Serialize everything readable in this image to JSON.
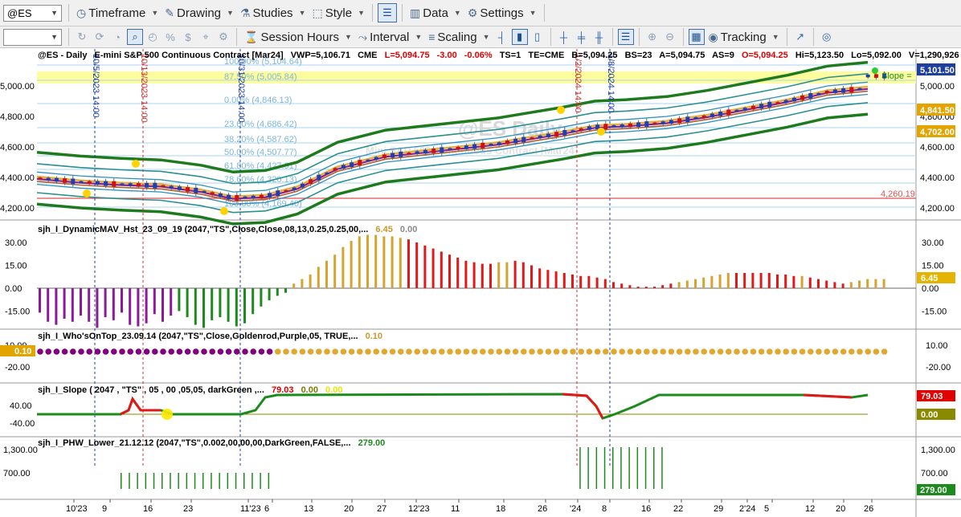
{
  "toolbar1": {
    "symbol": "@ES",
    "timeframe": "Timeframe",
    "drawing": "Drawing",
    "studies": "Studies",
    "style": "Style",
    "data": "Data",
    "settings": "Settings"
  },
  "toolbar2": {
    "combo_value": "",
    "session_hours": "Session Hours",
    "interval": "Interval",
    "scaling": "Scaling",
    "tracking": "Tracking"
  },
  "price_pane": {
    "header_symbol": "@ES - Daily",
    "header_desc": "E-mini S&P 500 Continuous Contract [Mar24]",
    "vwp": "VWP=5,106.71",
    "exchange": "CME",
    "last": "L=5,094.75",
    "chg": "-3.00",
    "pct": "-0.06%",
    "ts": "TS=1",
    "te": "TE=CME",
    "bid": "B=5,094.25",
    "bs": "BS=23",
    "ask": "A=5,094.75",
    "as": "AS=9",
    "open": "O=5,094.25",
    "hi": "Hi=5,123.50",
    "lo": "Lo=5,092.00",
    "vol": "V=1,290,926",
    "watermark": "@ES Daily",
    "watermark_sub": "Mini S&P 500 Continuous Contract [Mar24]",
    "slope_label": "Slope =",
    "axis_ticks": [
      "5,000.00",
      "4,800.00",
      "4,600.00",
      "4,400.00",
      "4,200.00"
    ],
    "badges": {
      "last": "5,101.50",
      "green": "4,841.50",
      "orange": "4,702.00",
      "red": "4,260.19"
    },
    "fib_levels": [
      "100.00% (5,104.64)",
      "87.50% (5,005.84)",
      "0.00% (4,846.13)",
      "23.60% (4,686.42)",
      "38.20% (4,587.62)",
      "50.00% (4,507.77)",
      "61.80% (4,427.91)",
      "78.60% (4,320.13)",
      "100.00% (4,169.40)"
    ],
    "vlines": [
      "10/5/2023 14:00",
      "10/13/2023 14:00",
      "10/31/2023 14:00",
      "1/2/2024 14:00",
      "1/8/2024 14:00"
    ]
  },
  "hist_pane": {
    "title": "sjh_I_DynamicMAV_Hst_23_09_19 (2047,\"TS\",Close,Close,08,13,0.25,0.25,00,...",
    "v1": "6.45",
    "v2": "0.00",
    "axis_ticks": [
      "30.00",
      "15.00",
      "0.00",
      "-15.00"
    ],
    "badge": "6.45",
    "bars": [
      -16,
      -22,
      -24,
      -20,
      -22,
      -18,
      -22,
      -26,
      -19,
      -21,
      -16,
      -24,
      -25,
      -23,
      -17,
      -22,
      -18,
      -15,
      -19,
      -24,
      -26,
      -21,
      -19,
      -22,
      -25,
      -23,
      -17,
      -12,
      -8,
      -5,
      -3,
      3,
      6,
      9,
      14,
      18,
      22,
      27,
      31,
      34,
      35,
      35,
      34,
      34,
      33,
      32,
      30,
      28,
      26,
      24,
      22,
      20,
      18,
      17,
      16,
      16,
      17,
      17,
      18,
      17,
      15,
      13,
      12,
      11,
      10,
      9,
      8,
      8,
      7,
      6,
      4,
      3,
      2,
      1,
      1,
      1,
      2,
      3,
      4,
      5,
      6,
      7,
      8,
      9,
      10,
      10,
      10,
      10,
      10,
      10,
      9,
      9,
      8,
      8,
      7,
      6,
      5,
      4,
      3,
      4,
      5,
      6,
      6,
      6
    ],
    "colors": [
      "p",
      "p",
      "p",
      "p",
      "p",
      "p",
      "p",
      "p",
      "p",
      "p",
      "p",
      "p",
      "p",
      "p",
      "p",
      "p",
      "p",
      "g",
      "g",
      "g",
      "g",
      "g",
      "g",
      "g",
      "g",
      "g",
      "g",
      "g",
      "g",
      "g",
      "g",
      "o",
      "o",
      "o",
      "o",
      "o",
      "o",
      "o",
      "o",
      "o",
      "o",
      "o",
      "o",
      "o",
      "o",
      "r",
      "r",
      "r",
      "r",
      "r",
      "r",
      "r",
      "r",
      "r",
      "r",
      "r",
      "o",
      "o",
      "r",
      "r",
      "r",
      "r",
      "r",
      "r",
      "r",
      "r",
      "r",
      "r",
      "r",
      "r",
      "r",
      "r",
      "r",
      "r",
      "r",
      "r",
      "r",
      "r",
      "o",
      "o",
      "o",
      "o",
      "o",
      "o",
      "o",
      "r",
      "r",
      "r",
      "r",
      "r",
      "r",
      "r",
      "r",
      "o",
      "r",
      "r",
      "r",
      "r",
      "r",
      "o",
      "o",
      "o",
      "o",
      "o"
    ]
  },
  "top_pane": {
    "title": "sjh_I_Who'sOnTop_23.09.14 (2047,\"TS\",Close,Goldenrod,Purple,05,  TRUE,...",
    "v1": "0.10",
    "axis_ticks": [
      "10.00",
      "-20.00"
    ],
    "badge_left": "0.10"
  },
  "slope_pane": {
    "title": "sjh_I_Slope ( 2047 , \"TS\" , 05 , 00 ,05,05, darkGreen ,...",
    "v1": "79.03",
    "v2": "0.00",
    "v3": "0.00",
    "axis_ticks": [
      "40.00",
      "-40.00"
    ],
    "badge_red": "79.03",
    "badge_olive": "0.00"
  },
  "phw_pane": {
    "title": "sjh_I_PHW_Lower_21.12.12 (2047,\"TS\",0.002,00,00,00,DarkGreen,FALSE,...",
    "v1": "279.00",
    "axis_ticks": [
      "1,300.00",
      "700.00"
    ],
    "badge": "279.00",
    "bars": [
      0,
      0,
      0,
      0,
      0,
      0,
      0,
      0,
      0,
      0,
      0,
      0,
      0,
      0,
      0,
      0,
      0,
      0,
      0,
      0,
      0,
      0,
      0,
      0,
      0,
      0,
      0,
      0,
      0,
      0,
      0,
      0,
      0,
      0,
      0,
      0,
      0,
      0,
      0,
      0,
      0,
      0,
      0,
      0,
      0,
      0,
      0,
      0,
      0,
      0,
      0,
      0,
      0,
      0,
      0,
      0,
      0,
      0,
      0,
      0,
      0,
      0,
      0,
      0,
      0,
      0,
      0,
      0,
      0,
      0,
      0,
      0,
      0,
      0,
      0,
      0,
      0,
      0,
      0,
      0,
      0,
      0,
      0,
      0,
      0,
      0,
      0,
      0,
      0,
      0,
      0,
      0,
      0,
      0,
      0,
      0,
      0,
      0,
      0,
      0,
      0,
      0,
      0,
      0
    ]
  },
  "xaxis": [
    "10'23",
    "9",
    "16",
    "23",
    "11'23",
    "6",
    "13",
    "20",
    "27",
    "12'23",
    "11",
    "18",
    "26",
    "'24",
    "8",
    "16",
    "22",
    "29",
    "2'24",
    "5",
    "12",
    "20",
    "26"
  ]
}
